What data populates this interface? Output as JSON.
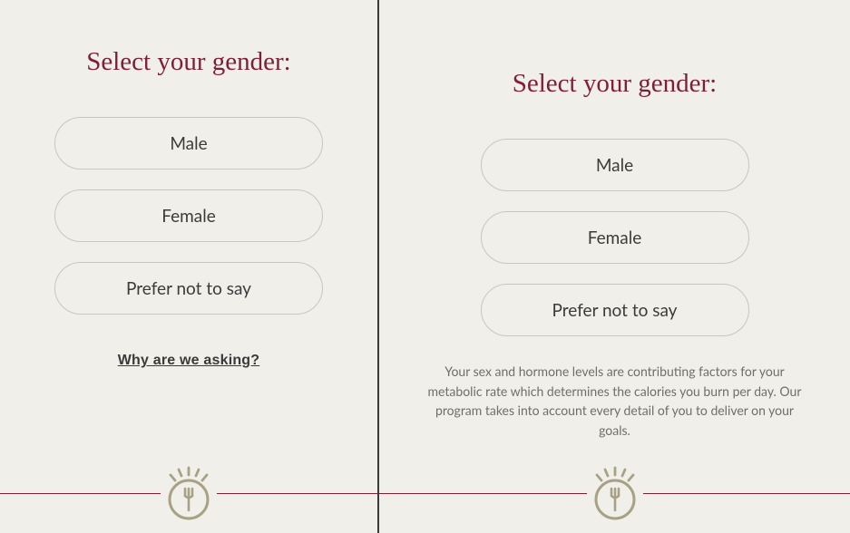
{
  "left": {
    "heading": "Select your gender:",
    "options": [
      "Male",
      "Female",
      "Prefer not to say"
    ],
    "why_link": "Why are we asking?"
  },
  "right": {
    "heading": "Select your gender:",
    "options": [
      "Male",
      "Female",
      "Prefer not to say"
    ],
    "explanation": "Your sex and hormone levels are contributing factors for your metabolic rate which determines the calories you burn per day. Our program takes into account every detail of you to deliver on your goals."
  },
  "colors": {
    "accent": "#7f1f36",
    "badge": "#a7a284"
  }
}
